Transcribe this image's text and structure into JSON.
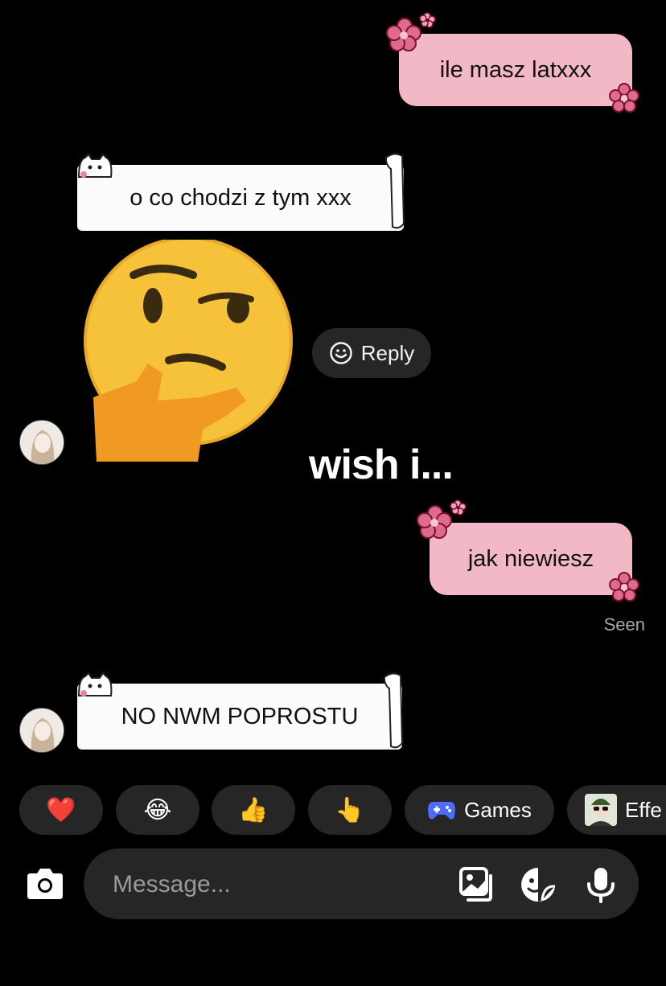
{
  "messages": {
    "m1": {
      "text": "ile masz latxxx",
      "direction": "outgoing"
    },
    "m2": {
      "text": "o co chodzi z tym xxx",
      "direction": "incoming"
    },
    "sticker": {
      "name": "thinking-face-sticker"
    },
    "m3": {
      "text": "wish i...",
      "direction": "outgoing"
    },
    "m4": {
      "text": "jak niewiesz",
      "direction": "outgoing"
    },
    "m5": {
      "text": "NO NWM POPROSTU",
      "direction": "incoming"
    }
  },
  "reply": {
    "label": "Reply",
    "icon": "smiley-icon"
  },
  "status": {
    "seen": "Seen"
  },
  "quick_actions": [
    {
      "icon": "heart-emoji",
      "glyph": "❤️"
    },
    {
      "icon": "laughing-emoji",
      "glyph": "😂"
    },
    {
      "icon": "thumbs-up-emoji",
      "glyph": "👍"
    },
    {
      "icon": "pointing-hand-emoji",
      "glyph": "👆"
    },
    {
      "icon": "gamepad-icon",
      "label": "Games"
    },
    {
      "icon": "effects-avatar-icon",
      "label": "Effe"
    }
  ],
  "composer": {
    "placeholder": "Message...",
    "icons": [
      "camera-icon",
      "gallery-icon",
      "sticker-icon",
      "microphone-icon"
    ]
  },
  "colors": {
    "background": "#000000",
    "outgoing_bubble": "#f2b8c6",
    "incoming_bubble": "#fbfbfb",
    "pill": "#262626",
    "flower": "#d9466f"
  }
}
